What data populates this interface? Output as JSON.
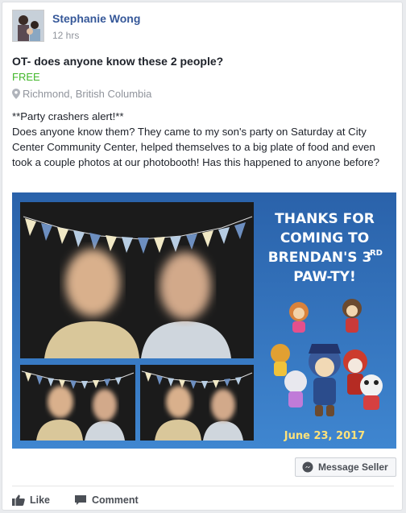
{
  "post": {
    "author": "Stephanie Wong",
    "time": "12 hrs",
    "title": "OT- does anyone know these 2 people?",
    "price": "FREE",
    "location": "Richmond, British Columbia",
    "body_line1": "**Party crashers alert!**",
    "body_line2": "Does anyone know them? They came to my son's party on Saturday at City Center Community Center, helped themselves to a big plate of food and even took a couple photos at our photobooth! Has this happened to anyone before?"
  },
  "photo": {
    "line1": "THANKS FOR",
    "line2": "COMING TO",
    "line3": "BRENDAN'S 3",
    "superscript": "RD",
    "line4": "PAW-TY!",
    "date": "June 23, 2017"
  },
  "actions": {
    "message_seller": "Message Seller",
    "like": "Like",
    "comment": "Comment"
  },
  "colors": {
    "link": "#365899",
    "price": "#42b72a",
    "photo_bg": "#2d6fb9"
  },
  "icons": [
    "location-pin-icon",
    "messenger-icon",
    "like-thumb-icon",
    "comment-icon"
  ]
}
